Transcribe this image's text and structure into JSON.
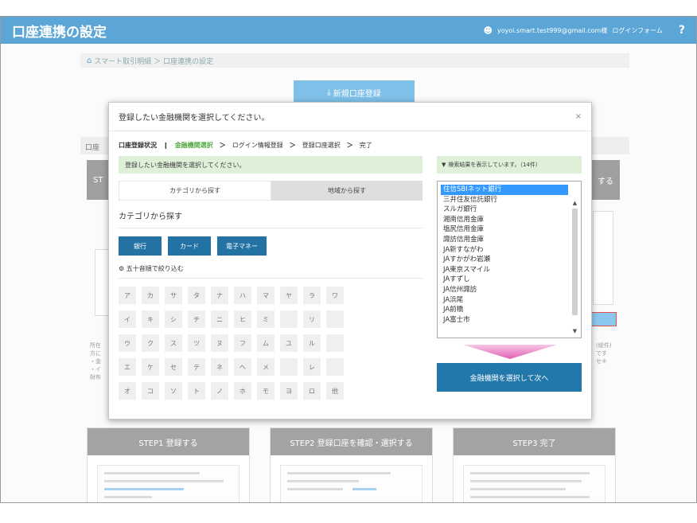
{
  "app": {
    "title": "口座連携の設定",
    "user_email": "yoyoi.smart.test999@gmail.com様",
    "logout_label": "ログインフォーム",
    "help_symbol": "?"
  },
  "background": {
    "breadcrumb_home": "スマート取引明細",
    "breadcrumb_sep": "＞",
    "breadcrumb_current": "口座連携の設定",
    "register_button": "新規口座登録",
    "section_label": "口座",
    "step_left_stub": "ST",
    "step_right_stub": "する",
    "left_notes": [
      "所在",
      "方に",
      "・金",
      "・イ",
      "財布"
    ],
    "right_notes": [
      "(総件)",
      "です",
      "セキ"
    ],
    "step_cards": [
      "STEP1 登録する",
      "STEP2 登録口座を確認・選択する",
      "STEP3 完了"
    ]
  },
  "modal": {
    "title": "登録したい金融機関を選択してください。",
    "close_symbol": "×",
    "progress": {
      "label": "口座登録状況",
      "separator": "❙",
      "steps": [
        "金融機関選択",
        "ログイン情報登録",
        "登録口座選択",
        "完了"
      ],
      "arrow": "＞"
    },
    "hint": "登録したい金融機関を選択してください。",
    "result_text": "検索結果を表示しています。（14件）",
    "tabs": [
      "カテゴリから探す",
      "地域から探す"
    ],
    "category_heading": "カテゴリから探す",
    "categories": [
      "銀行",
      "カード",
      "電子マネー"
    ],
    "kana_heading": "五十音順で絞り込む",
    "kana": [
      "ア",
      "カ",
      "サ",
      "タ",
      "ナ",
      "ハ",
      "マ",
      "ヤ",
      "ラ",
      "ワ",
      "イ",
      "キ",
      "シ",
      "チ",
      "ニ",
      "ヒ",
      "ミ",
      "",
      "リ",
      "",
      "ウ",
      "ク",
      "ス",
      "ツ",
      "ヌ",
      "フ",
      "ム",
      "ユ",
      "ル",
      "",
      "エ",
      "ケ",
      "セ",
      "テ",
      "ネ",
      "ヘ",
      "メ",
      "",
      "レ",
      "",
      "オ",
      "コ",
      "ソ",
      "ト",
      "ノ",
      "ホ",
      "モ",
      "ヨ",
      "ロ",
      "他"
    ],
    "institutions": [
      "住信SBIネット銀行",
      "三井住友信託銀行",
      "スルガ銀行",
      "湘南信用金庫",
      "塩尻信用金庫",
      "諏訪信用金庫",
      "JA新すながわ",
      "JAすかがわ岩瀬",
      "JA東京スマイル",
      "JAすずし",
      "JA信州諏訪",
      "JA浜尾",
      "JA前橋",
      "JA富士市"
    ],
    "selected_index": 0,
    "next_button": "金融機関を選択して次へ"
  }
}
